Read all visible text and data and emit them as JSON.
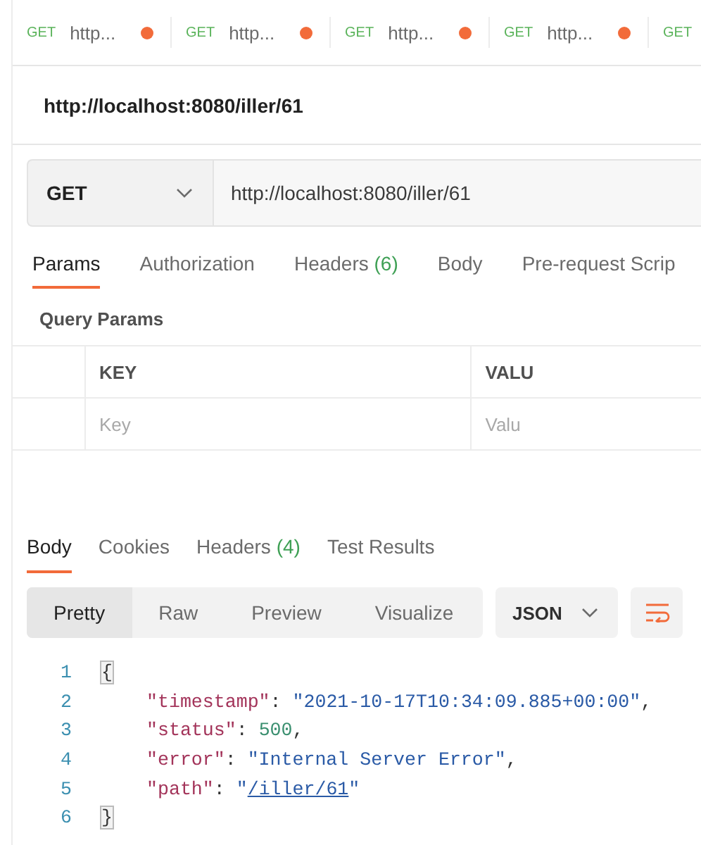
{
  "open_tabs": [
    {
      "method": "GET",
      "label": "http...",
      "modified": true
    },
    {
      "method": "GET",
      "label": "http...",
      "modified": true
    },
    {
      "method": "GET",
      "label": "http...",
      "modified": true
    },
    {
      "method": "GET",
      "label": "http...",
      "modified": true
    },
    {
      "method": "GET"
    }
  ],
  "request": {
    "title": "http://localhost:8080/iller/61",
    "method": "GET",
    "url": "http://localhost:8080/iller/61",
    "tabs": [
      {
        "label": "Params",
        "selected": true
      },
      {
        "label": "Authorization",
        "selected": false
      },
      {
        "label": "Headers",
        "count": "(6)",
        "selected": false
      },
      {
        "label": "Body",
        "selected": false
      },
      {
        "label": "Pre-request Scrip",
        "selected": false
      }
    ],
    "query_params": {
      "heading": "Query Params",
      "columns": [
        "KEY",
        "VALU"
      ],
      "placeholders": [
        "Key",
        "Valu"
      ]
    }
  },
  "response": {
    "tabs": [
      {
        "label": "Body",
        "selected": true
      },
      {
        "label": "Cookies",
        "selected": false
      },
      {
        "label": "Headers",
        "count": "(4)",
        "selected": false
      },
      {
        "label": "Test Results",
        "selected": false
      }
    ],
    "views": [
      {
        "label": "Pretty",
        "selected": true
      },
      {
        "label": "Raw",
        "selected": false
      },
      {
        "label": "Preview",
        "selected": false
      },
      {
        "label": "Visualize",
        "selected": false
      }
    ],
    "format": "JSON",
    "code": [
      {
        "number": "1",
        "indented": false,
        "tokens": [
          {
            "kind": "bracket",
            "text": "{"
          }
        ]
      },
      {
        "number": "2",
        "indented": true,
        "tokens": [
          {
            "kind": "key",
            "text": "\"timestamp\""
          },
          {
            "kind": "punct",
            "text": ": "
          },
          {
            "kind": "string",
            "text": "\"2021-10-17T10:34:09.885+00:00\""
          },
          {
            "kind": "punct",
            "text": ","
          }
        ]
      },
      {
        "number": "3",
        "indented": true,
        "tokens": [
          {
            "kind": "key",
            "text": "\"status\""
          },
          {
            "kind": "punct",
            "text": ": "
          },
          {
            "kind": "number",
            "text": "500"
          },
          {
            "kind": "punct",
            "text": ","
          }
        ]
      },
      {
        "number": "4",
        "indented": true,
        "tokens": [
          {
            "kind": "key",
            "text": "\"error\""
          },
          {
            "kind": "punct",
            "text": ": "
          },
          {
            "kind": "string",
            "text": "\"Internal Server Error\""
          },
          {
            "kind": "punct",
            "text": ","
          }
        ]
      },
      {
        "number": "5",
        "indented": true,
        "tokens": [
          {
            "kind": "key",
            "text": "\"path\""
          },
          {
            "kind": "punct",
            "text": ": "
          },
          {
            "kind": "string",
            "text": "\""
          },
          {
            "kind": "link",
            "text": "/iller/61"
          },
          {
            "kind": "string",
            "text": "\""
          }
        ]
      },
      {
        "number": "6",
        "indented": false,
        "tokens": [
          {
            "kind": "bracket",
            "text": "}"
          }
        ]
      }
    ]
  }
}
